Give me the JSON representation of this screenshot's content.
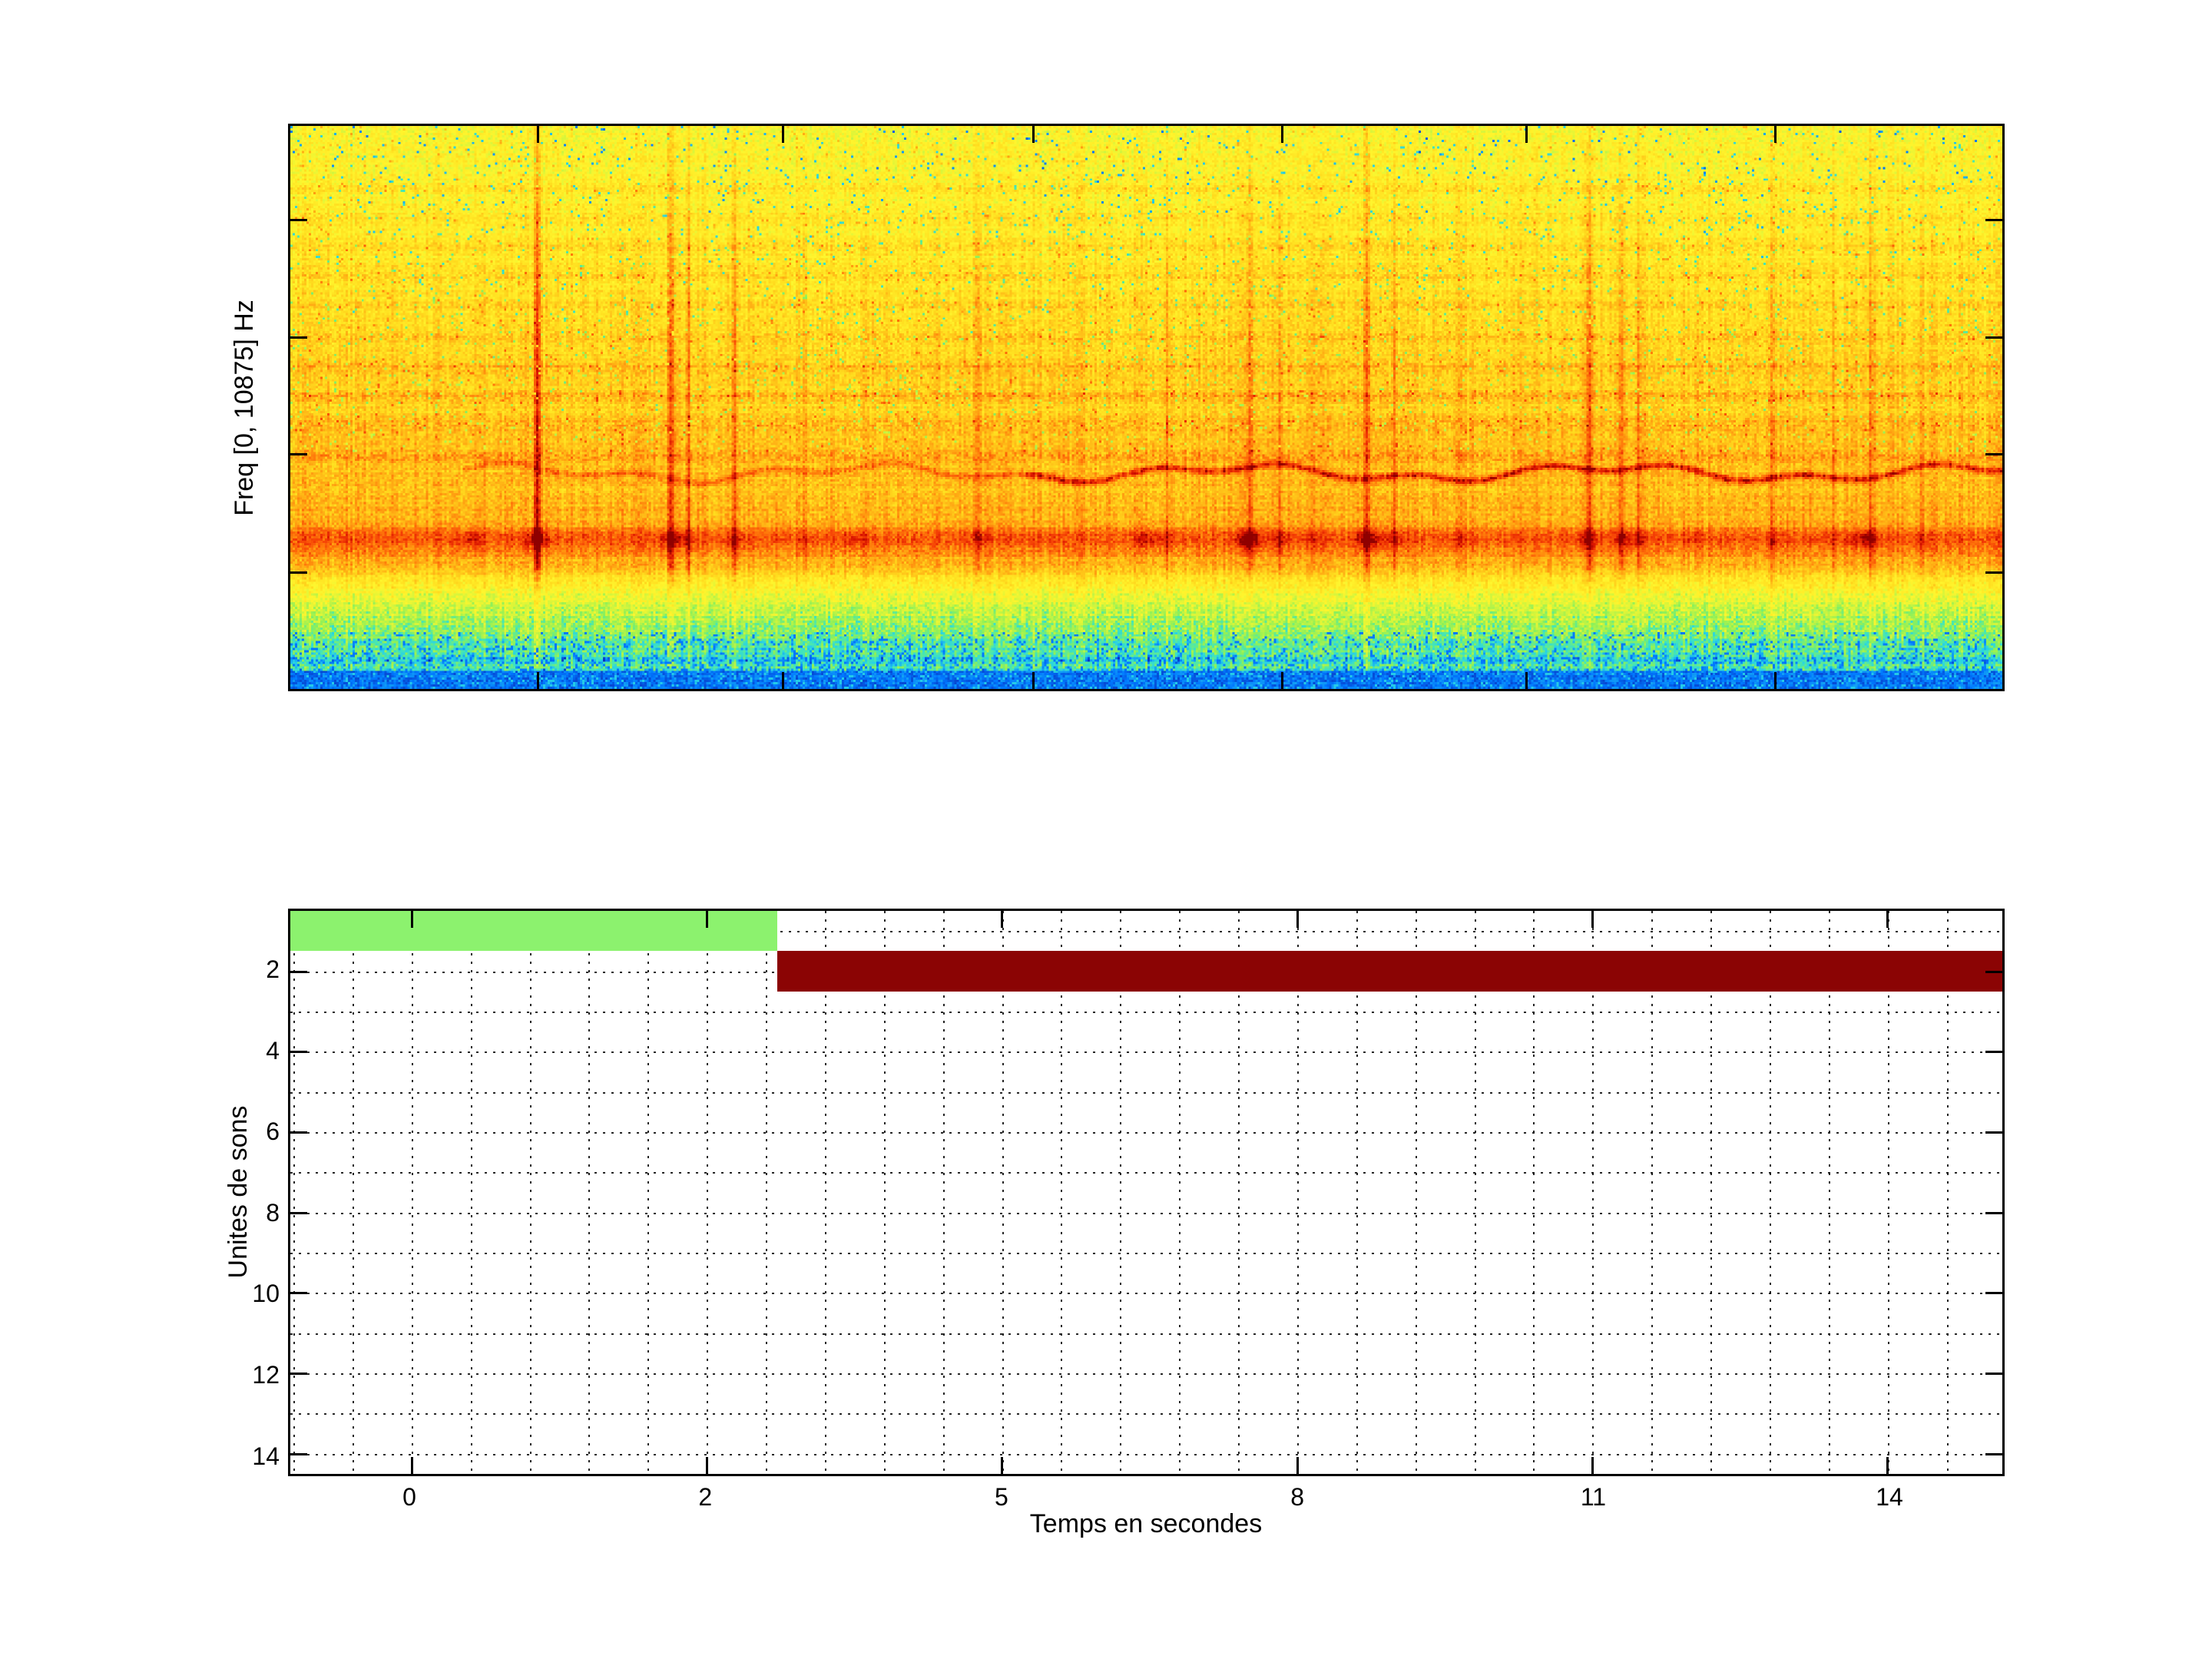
{
  "figure": {
    "background": "#FFFFFF"
  },
  "chart_data": [
    {
      "type": "heatmap",
      "name": "spectrogram",
      "title": "",
      "xlabel": "",
      "ylabel": "Freq [0, 10875] Hz",
      "x_tick_labels": [],
      "y_tick_labels": [],
      "side_tick_fractions": [
        0.167,
        0.375,
        0.583,
        0.792
      ],
      "topbottom_tick_fractions": [
        0.1445,
        0.2877,
        0.434,
        0.579,
        0.722,
        0.867
      ],
      "spectrogram": {
        "grid": {
          "cols": 745,
          "rows": 247
        },
        "palette": [
          [
            0,
            "#0A28B4"
          ],
          [
            0.05,
            "#0078FF"
          ],
          [
            0.105,
            "#28D2E6"
          ],
          [
            0.155,
            "#46E6B4"
          ],
          [
            0.21,
            "#8CF05A"
          ],
          [
            0.3,
            "#D2F53C"
          ],
          [
            0.4,
            "#FFF52D"
          ],
          [
            0.52,
            "#FFDC1E"
          ],
          [
            0.63,
            "#FFAF14"
          ],
          [
            0.73,
            "#FF780A"
          ],
          [
            0.83,
            "#F54005"
          ],
          [
            0.92,
            "#D71200"
          ],
          [
            1,
            "#8F0000"
          ]
        ],
        "profile": [
          [
            0,
            0.4
          ],
          [
            0.45,
            0.535
          ],
          [
            0.62,
            0.6
          ],
          [
            0.7,
            0.62
          ],
          [
            0.735,
            0.8
          ],
          [
            0.762,
            0.68
          ],
          [
            0.79,
            0.6
          ],
          [
            0.815,
            0.44
          ],
          [
            0.86,
            0.3
          ],
          [
            0.905,
            0.22
          ],
          [
            0.94,
            0.135
          ],
          [
            0.975,
            0.12
          ],
          [
            0.988,
            0.09
          ],
          [
            1,
            0.04
          ]
        ],
        "band_zone": {
          "start": 0.055,
          "end": 0.62,
          "step": 0.053,
          "base": 0.03,
          "gain": 0.1
        },
        "streaks": [
          [
            0.144,
            0.33,
            1.6
          ],
          [
            0.222,
            0.26,
            1.3
          ],
          [
            0.232,
            0.18,
            1.0
          ],
          [
            0.259,
            0.16,
            1.2
          ],
          [
            0.3,
            0.08,
            1.0
          ],
          [
            0.402,
            0.14,
            1.2
          ],
          [
            0.512,
            0.1,
            1.0
          ],
          [
            0.561,
            0.2,
            1.5
          ],
          [
            0.578,
            0.16,
            1.0
          ],
          [
            0.597,
            0.1,
            1.0
          ],
          [
            0.629,
            0.18,
            1.3
          ],
          [
            0.645,
            0.15,
            1.0
          ],
          [
            0.684,
            0.1,
            1.0
          ],
          [
            0.759,
            0.24,
            1.5
          ],
          [
            0.778,
            0.19,
            1.2
          ],
          [
            0.788,
            0.16,
            1.0
          ],
          [
            0.822,
            0.08,
            1.0
          ],
          [
            0.866,
            0.1,
            1.0
          ],
          [
            0.902,
            0.08,
            1.0
          ],
          [
            0.924,
            0.14,
            1.3
          ],
          [
            0.953,
            0.08,
            1.0
          ]
        ],
        "blobs": [
          [
            0.105,
            0.12
          ],
          [
            0.33,
            0.1
          ],
          [
            0.5,
            0.12
          ],
          [
            0.56,
            0.14
          ],
          [
            0.63,
            0.12
          ],
          [
            0.92,
            0.1
          ]
        ],
        "wavy": {
          "fy": 0.617,
          "amp1": 0.011,
          "freq1": 29,
          "amp2": 0.007,
          "freq2": 83,
          "weak": 0.15,
          "strong": 0.3,
          "strong_from": 0.43,
          "visible_from": 0.1
        },
        "low_band_fy": 0.735
      }
    },
    {
      "type": "bar",
      "name": "units-timeline",
      "title": "",
      "xlabel": "Temps en secondes",
      "ylabel": "Unites de sons",
      "ylim": [
        0.5,
        14.5
      ],
      "x_ticks": [
        {
          "label": "0",
          "frac": 0.0707
        },
        {
          "label": "2",
          "frac": 0.2431
        },
        {
          "label": "5",
          "frac": 0.4156
        },
        {
          "label": "8",
          "frac": 0.588
        },
        {
          "label": "11",
          "frac": 0.7604
        },
        {
          "label": "14",
          "frac": 0.9329
        }
      ],
      "y_ticks": [
        {
          "label": "2",
          "frac": 0.10714
        },
        {
          "label": "4",
          "frac": 0.25
        },
        {
          "label": "6",
          "frac": 0.39286
        },
        {
          "label": "8",
          "frac": 0.53571
        },
        {
          "label": "10",
          "frac": 0.67857
        },
        {
          "label": "12",
          "frac": 0.82143
        },
        {
          "label": "14",
          "frac": 0.96429
        }
      ],
      "h_grid_rows": 14,
      "v_grid": {
        "offset_frac": 0.0018,
        "step_frac": 0.034489
      },
      "segments": [
        {
          "name": "segment-green",
          "row": 1,
          "start_frac": 0.0,
          "end_frac": 0.2845,
          "color": "#8CF26E"
        },
        {
          "name": "segment-red",
          "row": 2,
          "start_frac": 0.2845,
          "end_frac": 1.0,
          "color": "#8B0404"
        }
      ]
    }
  ]
}
